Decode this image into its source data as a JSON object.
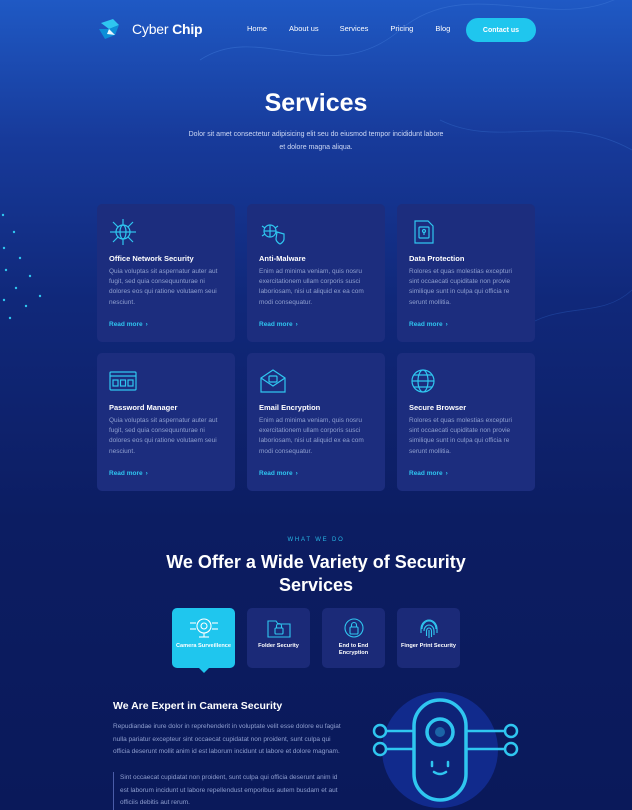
{
  "header": {
    "logo_text_light": "Cyber",
    "logo_text_bold": "Chip",
    "nav": [
      "Home",
      "About us",
      "Services",
      "Pricing",
      "Blog"
    ],
    "contact_label": "Contact us"
  },
  "hero": {
    "title": "Services",
    "description": "Dolor sit amet consectetur adipisicing elit seu do eiusmod tempor incididunt labore et dolore magna aliqua."
  },
  "services": [
    {
      "icon": "network-globe-icon",
      "title": "Office Network Security",
      "text": "Quia voluptas sit aspernatur auter aut fugit, sed quia consequunturae ni dolores eos qui ratione volutaem seui nesciunt.",
      "link": "Read more"
    },
    {
      "icon": "bug-shield-icon",
      "title": "Anti-Malware",
      "text": "Enim ad minima veniam, quis nosru exercitationem ullam corporis susci laboriosam, nisi ut aliquid ex ea com modi consequatur.",
      "link": "Read more"
    },
    {
      "icon": "document-lock-icon",
      "title": "Data Protection",
      "text": "Rolores et quas molestias excepturi sint occaecati cupiditate non provie similique sunt in culpa qui officia re serunt mollitia.",
      "link": "Read more"
    },
    {
      "icon": "password-field-icon",
      "title": "Password Manager",
      "text": "Quia voluptas sit aspernatur auter aut fugit, sed quia consequunturae ni dolores eos qui ratione volutaem seui nesciunt.",
      "link": "Read more"
    },
    {
      "icon": "envelope-lock-icon",
      "title": "Email Encryption",
      "text": "Enim ad minima veniam, quis nosru exercitationem ullam corporis susci laboriosam, nisi ut aliquid ex ea com modi consequatur.",
      "link": "Read more"
    },
    {
      "icon": "globe-browser-icon",
      "title": "Secure Browser",
      "text": "Rolores et quas molestias excepturi sint occaecati cupiditate non provie similique sunt in culpa qui officia re serunt mollitia.",
      "link": "Read more"
    }
  ],
  "offer": {
    "eyebrow": "WHAT WE DO",
    "title": "We Offer a Wide Variety of Security Services",
    "tabs": [
      {
        "label": "Camera Surveillence",
        "icon": "camera-icon",
        "active": true
      },
      {
        "label": "Folder Security",
        "icon": "folder-lock-icon",
        "active": false
      },
      {
        "label": "End to End Encryption",
        "icon": "lock-shield-icon",
        "active": false
      },
      {
        "label": "Finger Print Security",
        "icon": "fingerprint-icon",
        "active": false
      }
    ],
    "detail_title": "We Are Expert in Camera Security",
    "detail_text": "Repudiandae irure dolor in reprehenderit in voluptate velit esse dolore eu fagiat nulla pariatur excepteur sint occaecat cupidatat non proident, sunt culpa qui officia deserunt mollit anim id est laborum incidunt ut labore et dolore magnam.",
    "detail_quote": "Sint occaecat cupidatat non proident, sunt culpa qui officia deserunt anim id est laborum incidunt ut labore repellendust emporibus autem busdam et aut officiis debitis aut rerum."
  },
  "colors": {
    "accent": "#1fc6ee",
    "card_bg": "#1c2d7e",
    "link": "#2fc6f0",
    "muted_text": "#8f9fcf"
  }
}
